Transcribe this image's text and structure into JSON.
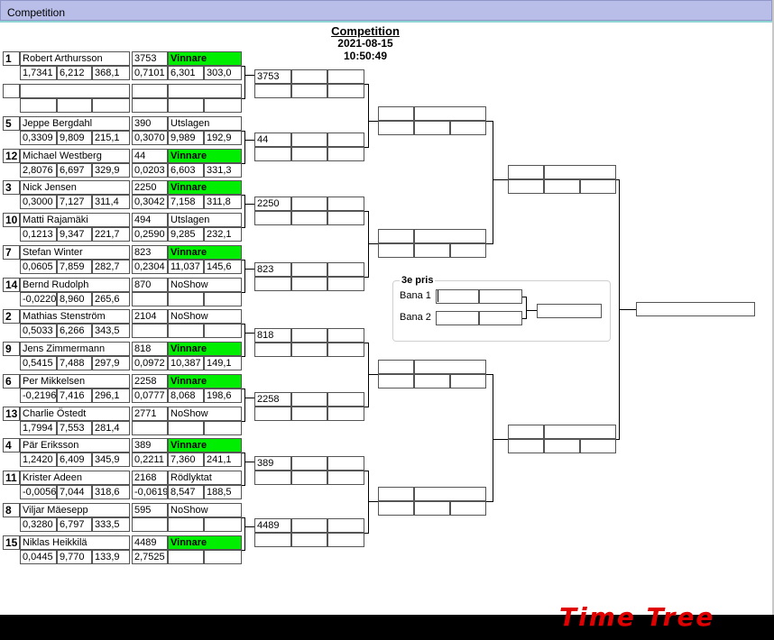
{
  "window": {
    "title": "Competition"
  },
  "competition": {
    "title": "Competition",
    "datetime": "2021-08-15 10:50:49"
  },
  "matches": [
    {
      "a": {
        "seed": "1",
        "name": "Robert Arthursson",
        "number": "3753",
        "status": "Vinnare",
        "rt": "1,7341",
        "et": "6,212",
        "speed": "368,1",
        "rt2": "0,7101",
        "et2": "6,301",
        "speed2": "303,0"
      },
      "b": {
        "seed": "",
        "name": "",
        "number": "",
        "status": "",
        "rt": "",
        "et": "",
        "speed": "",
        "rt2": "",
        "et2": "",
        "speed2": ""
      }
    },
    {
      "a": {
        "seed": "5",
        "name": "Jeppe Bergdahl",
        "number": "390",
        "status": "Utslagen",
        "rt": "0,3309",
        "et": "9,809",
        "speed": "215,1",
        "rt2": "0,3070",
        "et2": "9,989",
        "speed2": "192,9"
      },
      "b": {
        "seed": "12",
        "name": "Michael Westberg",
        "number": "44",
        "status": "Vinnare",
        "rt": "2,8076",
        "et": "6,697",
        "speed": "329,9",
        "rt2": "0,0203",
        "et2": "6,603",
        "speed2": "331,3"
      }
    },
    {
      "a": {
        "seed": "3",
        "name": "Nick  Jensen",
        "number": "2250",
        "status": "Vinnare",
        "rt": "0,3000",
        "et": "7,127",
        "speed": "311,4",
        "rt2": "0,3042",
        "et2": "7,158",
        "speed2": "311,8"
      },
      "b": {
        "seed": "10",
        "name": "Matti Rajamäki",
        "number": "494",
        "status": "Utslagen",
        "rt": "0,1213",
        "et": "9,347",
        "speed": "221,7",
        "rt2": "0,2590",
        "et2": "9,285",
        "speed2": "232,1"
      }
    },
    {
      "a": {
        "seed": "7",
        "name": "Stefan Winter",
        "number": "823",
        "status": "Vinnare",
        "rt": "0,0605",
        "et": "7,859",
        "speed": "282,7",
        "rt2": "0,2304",
        "et2": "11,037",
        "speed2": "145,6"
      },
      "b": {
        "seed": "14",
        "name": "Bernd Rudolph",
        "number": "870",
        "status": "NoShow",
        "rt": "-0,0220",
        "et": "8,960",
        "speed": "265,6",
        "rt2": "",
        "et2": "",
        "speed2": ""
      }
    },
    {
      "a": {
        "seed": "2",
        "name": "Mathias Stenström",
        "number": "2104",
        "status": "NoShow",
        "rt": "0,5033",
        "et": "6,266",
        "speed": "343,5",
        "rt2": "",
        "et2": "",
        "speed2": ""
      },
      "b": {
        "seed": "9",
        "name": "Jens Zimmermann",
        "number": "818",
        "status": "Vinnare",
        "rt": "0,5415",
        "et": "7,488",
        "speed": "297,9",
        "rt2": "0,0972",
        "et2": "10,387",
        "speed2": "149,1"
      }
    },
    {
      "a": {
        "seed": "6",
        "name": "Per Mikkelsen",
        "number": "2258",
        "status": "Vinnare",
        "rt": "-0,2196",
        "et": "7,416",
        "speed": "296,1",
        "rt2": "0,0777",
        "et2": "8,068",
        "speed2": "198,6"
      },
      "b": {
        "seed": "13",
        "name": "Charlie Östedt",
        "number": "2771",
        "status": "NoShow",
        "rt": "1,7994",
        "et": "7,553",
        "speed": "281,4",
        "rt2": "",
        "et2": "",
        "speed2": ""
      }
    },
    {
      "a": {
        "seed": "4",
        "name": "Pär Eriksson",
        "number": "389",
        "status": "Vinnare",
        "rt": "1,2420",
        "et": "6,409",
        "speed": "345,9",
        "rt2": "0,2211",
        "et2": "7,360",
        "speed2": "241,1"
      },
      "b": {
        "seed": "11",
        "name": "Krister Adeen",
        "number": "2168",
        "status": "Rödlyktat",
        "rt": "-0,0056",
        "et": "7,044",
        "speed": "318,6",
        "rt2": "-0,0619",
        "et2": "8,547",
        "speed2": "188,5"
      }
    },
    {
      "a": {
        "seed": "8",
        "name": "Viljar Mäesepp",
        "number": "595",
        "status": "NoShow",
        "rt": "0,3280",
        "et": "6,797",
        "speed": "333,5",
        "rt2": "",
        "et2": "",
        "speed2": ""
      },
      "b": {
        "seed": "15",
        "name": "Niklas Heikkilä",
        "number": "4489",
        "status": "Vinnare",
        "rt": "0,0445",
        "et": "9,770",
        "speed": "133,9",
        "rt2": "2,7525",
        "et2": "",
        "speed2": ""
      }
    }
  ],
  "round2": [
    "3753",
    "44",
    "2250",
    "823",
    "818",
    "2258",
    "389",
    "4489"
  ],
  "third_prize": {
    "title": "3e pris",
    "lane1": "Bana 1",
    "lane2": "Bana 2"
  },
  "status_colors": {
    "winner": "#00ee00"
  },
  "logo_text": "Time Tree"
}
